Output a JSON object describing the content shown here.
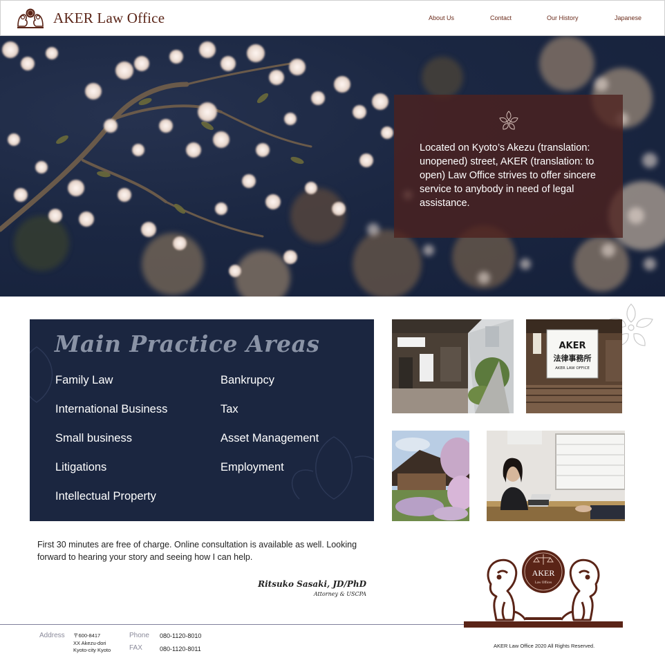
{
  "header": {
    "brand": "AKER Law Office",
    "nav": [
      {
        "label": "About Us"
      },
      {
        "label": "Contact"
      },
      {
        "label": "Our History"
      },
      {
        "label": "Japanese"
      }
    ]
  },
  "hero": {
    "text": "Located on Kyoto’s Akezu (translation: unopened) street, AKER (translation: to open) Law Office strives to offer sincere service to anybody in need of legal assistance."
  },
  "practice": {
    "title": "Main Practice Areas",
    "left": [
      "Family Law",
      "International Business",
      "Small business",
      "Litigations",
      "Intellectual Property"
    ],
    "right": [
      "Bankrupcy",
      "Tax",
      "Asset Management",
      "Employment"
    ]
  },
  "intro": {
    "text": "First 30 minutes are free of charge. Online consultation is available as well. Looking forward to hearing your story and seeing how I can help.",
    "signature": "Ritsuko Sasaki, JD/PhD",
    "signature_title": "Attorney & USCPA"
  },
  "photos": {
    "sign_text": "AKER",
    "sign_kanji": "法律事務所",
    "sign_sub": "AKER LAW OFFICE"
  },
  "logo": {
    "name": "AKER",
    "sub": "Law Offices"
  },
  "footer": {
    "address_label": "Address",
    "address_lines": [
      "〒600-8417",
      "XX Akezu-dori",
      "Kyoto-city Kyoto"
    ],
    "phone_label": "Phone",
    "phone": "080-1120-8010",
    "fax_label": "FAX",
    "fax": "080-1120-8011",
    "copyright": "AKER Law Office 2020 All Rights Reserved."
  },
  "colors": {
    "brand": "#5a2417",
    "navy": "#1b2640",
    "hero_box": "#4e211e"
  },
  "icons": {
    "brand": "lion-crest-icon",
    "hero": "sakura-flower-icon"
  }
}
